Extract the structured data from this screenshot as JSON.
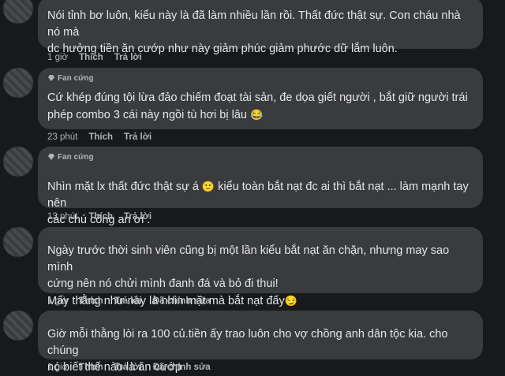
{
  "comments": [
    {
      "badge": "",
      "text": "Nói tỉnh bơ luôn, kiểu này là đã làm nhiều lần rồi. Thất đức thật sự. Con cháu nhà nó mà\ndc hưởng tiền ăn cướp như này giảm phúc giảm phước dữ lắm luôn.",
      "time": "1 giờ",
      "like": "Thích",
      "reply": "Trả lời",
      "edited": ""
    },
    {
      "badge": "Fan cứng",
      "text": "Cứ khép đúng tội lừa đảo chiếm đoạt tài sản, đe dọa giết người , bắt giữ người trái\nphép combo 3 cái này ngồi tù hơi bị lâu",
      "emoji": "😂",
      "time": "23 phút",
      "like": "Thích",
      "reply": "Trả lời",
      "edited": ""
    },
    {
      "badge": "Fan cứng",
      "text_a": "Nhìn mặt lx thất đức thật sự á",
      "emoji": "🙂",
      "text_b": " kiểu toàn bắt nạt đc ai thì bắt nạt ... làm mạnh tay nên\ncác chú công an ơi .",
      "time": "13 phút",
      "like": "Thích",
      "reply": "Trả lời",
      "edited": ""
    },
    {
      "badge": "",
      "text": "Ngày trước thời sinh viên cũng bị một lần kiểu bắt nạt ăn chặn, nhưng may sao mình\ncứng nên nó chửi mình đanh đá và bỏ đi thui!\nMấy thằng như này là nhìn mặt mà bắt nạt đấy",
      "emoji": "😏",
      "time": "1 giờ",
      "like": "Thích",
      "reply": "Trả lời",
      "edited": "Đã chỉnh sửa"
    },
    {
      "badge": "",
      "text": "Giờ mỗi thằng lòi ra 100 củ.tiền ấy trao luôn cho vợ chồng anh dân tộc kia. cho chúng\nnó biết thế nào là ăn cướp",
      "time": "1 giờ",
      "like": "Thích",
      "reply": "Trả lời",
      "edited": "Đã chỉnh sửa"
    }
  ],
  "colors": {
    "page_bg": "#18191a",
    "bubble_bg": "#3a3b3c",
    "text": "#e4e6eb",
    "secondary": "#b0b3b8"
  }
}
